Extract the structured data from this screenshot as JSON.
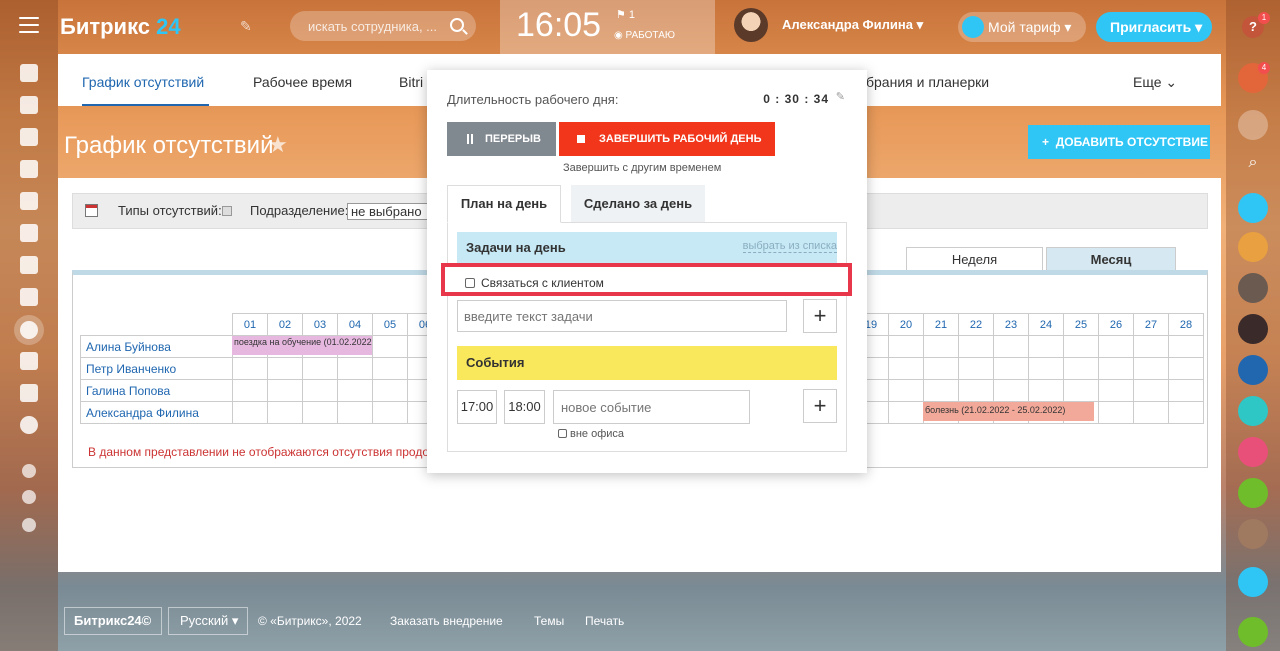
{
  "header": {
    "logo_name": "Битрикс",
    "logo_num": "24",
    "search_placeholder": "искать сотрудника, ...",
    "clock": "16:05",
    "flag_count": "1",
    "status": "РАБОТАЮ",
    "user_name": "Александра Филина",
    "tariff": "Мой тариф",
    "invite": "Пригласить"
  },
  "right_badges": {
    "help": "?",
    "notifications": "4"
  },
  "tabs": [
    "График отсутствий",
    "Рабочее время",
    "Bitri",
    "брания и планерки",
    "Еще"
  ],
  "page": {
    "title": "График отсутствий",
    "add_button": "ДОБАВИТЬ ОТСУТСТВИЕ"
  },
  "filter": {
    "types_label": "Типы отсутствий:",
    "dept_label": "Подразделение:",
    "dept_value": "не выбрано"
  },
  "view_tabs": [
    "Неделя",
    "Месяц"
  ],
  "calendar": {
    "days_left": [
      "01",
      "02",
      "03",
      "04",
      "05",
      "06"
    ],
    "days_right": [
      "19",
      "20",
      "21",
      "22",
      "23",
      "24",
      "25",
      "26",
      "27",
      "28"
    ],
    "employees": [
      "Алина Буйнова",
      "Петр Иванченко",
      "Галина Попова",
      "Александра Филина"
    ],
    "event1": "поездка на обучение (01.02.2022",
    "event2": "болезнь (21.02.2022 - 25.02.2022)",
    "note": "В данном представлении не отображаются отсутствия продол"
  },
  "popup": {
    "duration_label": "Длительность рабочего дня:",
    "duration_value": "0 : 30 : 34",
    "pause": "ПЕРЕРЫВ",
    "finish": "ЗАВЕРШИТЬ РАБОЧИЙ ДЕНЬ",
    "finish_other": "Завершить с другим временем",
    "tab_plan": "План на день",
    "tab_done": "Сделано за день",
    "tasks_title": "Задачи на день",
    "tasks_pick": "выбрать из списка",
    "task_item": "Связаться с клиентом",
    "task_placeholder": "введите текст задачи",
    "events_title": "События",
    "time_from": "17:00",
    "time_to": "18:00",
    "event_placeholder": "новое событие",
    "offsite": "вне офиса"
  },
  "footer": {
    "logo": "Битрикс24©",
    "lang": "Русский",
    "copyright": "© «Битрикс», 2022",
    "order": "Заказать внедрение",
    "themes": "Темы",
    "print": "Печать"
  }
}
